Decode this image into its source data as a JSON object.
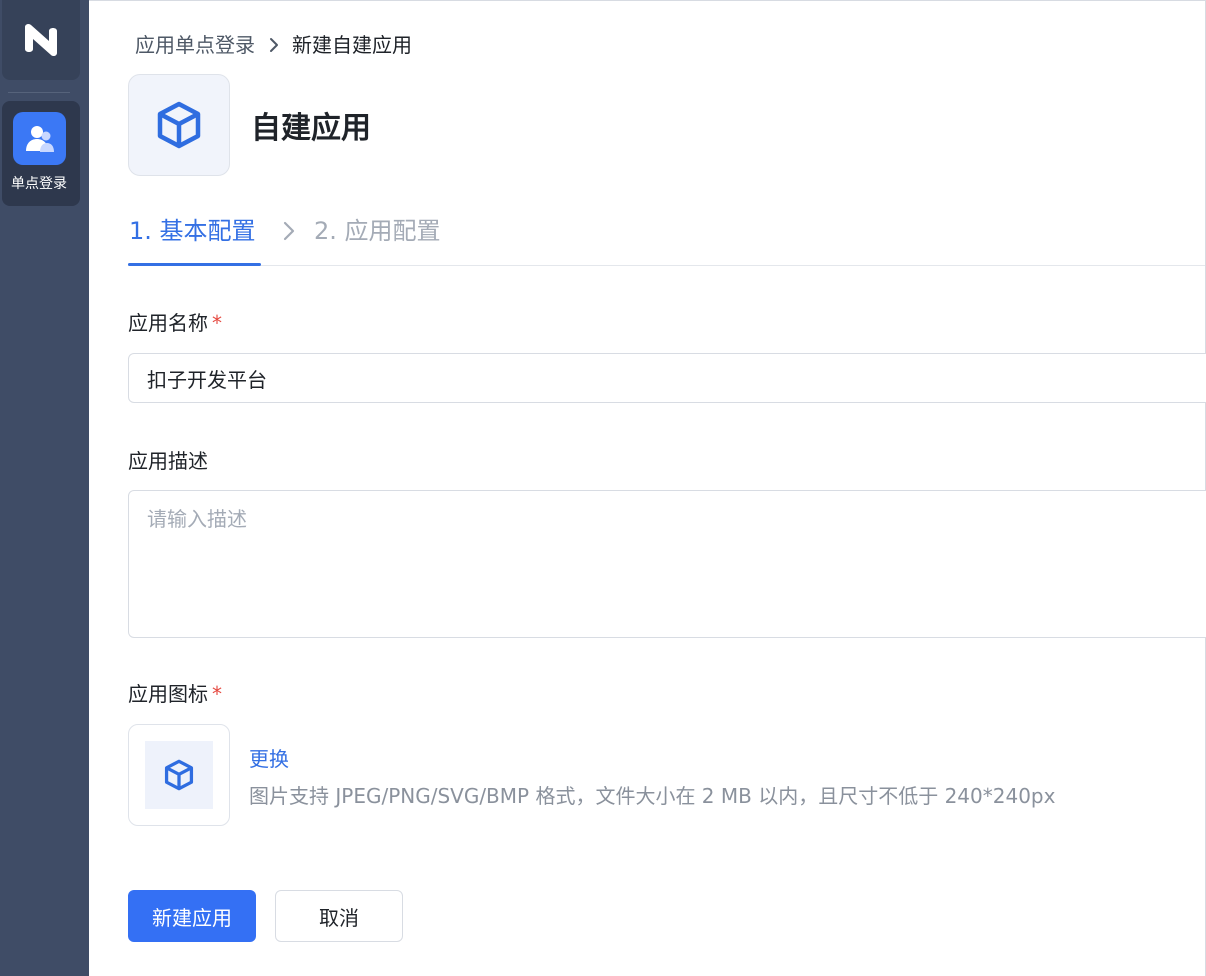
{
  "sidebar": {
    "nav_items": [
      {
        "label": "单点登录"
      }
    ]
  },
  "breadcrumb": {
    "parent": "应用单点登录",
    "current": "新建自建应用"
  },
  "app": {
    "title": "自建应用"
  },
  "steps": [
    {
      "label": "1. 基本配置",
      "active": true
    },
    {
      "label": "2. 应用配置",
      "active": false
    }
  ],
  "form": {
    "name": {
      "label": "应用名称",
      "required_mark": "*",
      "value": "扣子开发平台"
    },
    "description": {
      "label": "应用描述",
      "placeholder": "请输入描述"
    },
    "icon": {
      "label": "应用图标",
      "required_mark": "*",
      "change_label": "更换",
      "hint": "图片支持 JPEG/PNG/SVG/BMP 格式，文件大小在 2 MB 以内，且尺寸不低于 240*240px"
    }
  },
  "actions": {
    "submit_label": "新建应用",
    "cancel_label": "取消"
  },
  "colors": {
    "accent": "#3470e4",
    "sidebar_bg": "#3f4c66",
    "required": "#e5483f"
  }
}
